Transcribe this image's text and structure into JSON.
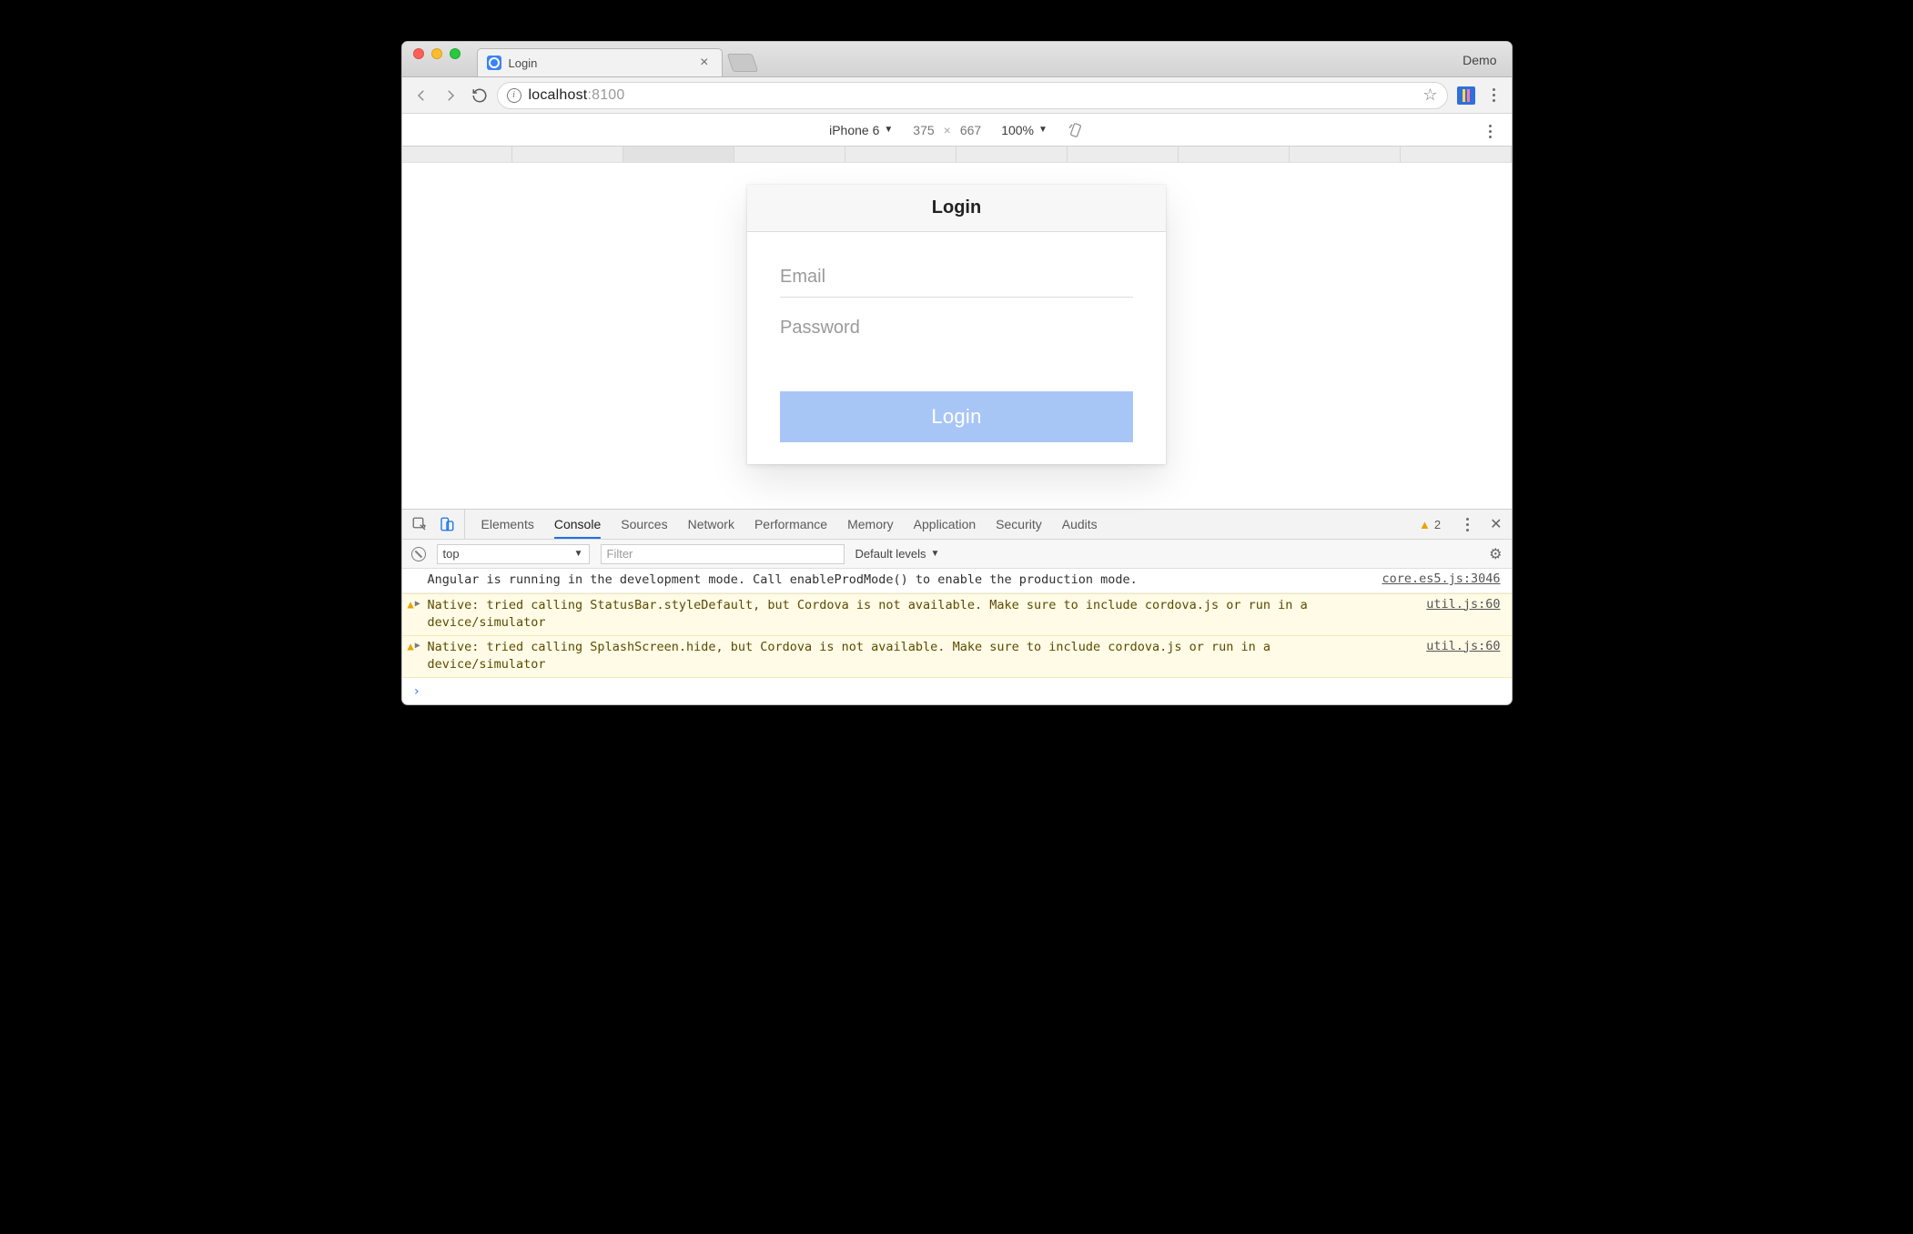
{
  "browser": {
    "tab_title": "Login",
    "profile": "Demo",
    "url_host": "localhost",
    "url_port": ":8100"
  },
  "device_toolbar": {
    "device": "iPhone 6",
    "width": "375",
    "height": "667",
    "zoom": "100%"
  },
  "app": {
    "header": "Login",
    "email_placeholder": "Email",
    "password_placeholder": "Password",
    "login_button": "Login"
  },
  "devtools": {
    "tabs": [
      "Elements",
      "Console",
      "Sources",
      "Network",
      "Performance",
      "Memory",
      "Application",
      "Security",
      "Audits"
    ],
    "active_tab": "Console",
    "warning_count": "2",
    "context": "top",
    "filter_placeholder": "Filter",
    "levels_label": "Default levels",
    "messages": [
      {
        "type": "log",
        "text": "Angular is running in the development mode. Call enableProdMode() to enable the production mode.",
        "source": "core.es5.js:3046"
      },
      {
        "type": "warn",
        "text": "Native: tried calling StatusBar.styleDefault, but Cordova is not available. Make sure to include cordova.js or run in a device/simulator",
        "source": "util.js:60"
      },
      {
        "type": "warn",
        "text": "Native: tried calling SplashScreen.hide, but Cordova is not available. Make sure to include cordova.js or run in a device/simulator",
        "source": "util.js:60"
      }
    ]
  }
}
